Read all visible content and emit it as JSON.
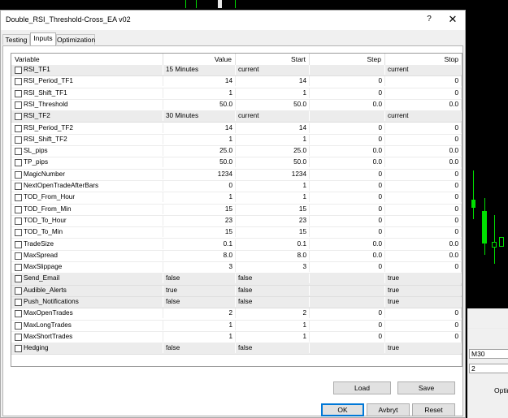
{
  "dialog": {
    "title": "Double_RSI_Threshold-Cross_EA v02",
    "help_label": "?",
    "close_label": "✕"
  },
  "tabs": [
    {
      "label": "Testing"
    },
    {
      "label": "Inputs"
    },
    {
      "label": "Optimization"
    }
  ],
  "columns": [
    "Variable",
    "Value",
    "Start",
    "Step",
    "Stop"
  ],
  "rows": [
    {
      "name": "RSI_TF1",
      "value": "15 Minutes",
      "start": "current",
      "step": "",
      "stop": "current",
      "kind": "text"
    },
    {
      "name": "RSI_Period_TF1",
      "value": "14",
      "start": "14",
      "step": "0",
      "stop": "0",
      "kind": "num"
    },
    {
      "name": "RSI_Shift_TF1",
      "value": "1",
      "start": "1",
      "step": "0",
      "stop": "0",
      "kind": "num"
    },
    {
      "name": "RSI_Threshold",
      "value": "50.0",
      "start": "50.0",
      "step": "0.0",
      "stop": "0.0",
      "kind": "num"
    },
    {
      "name": "RSI_TF2",
      "value": "30 Minutes",
      "start": "current",
      "step": "",
      "stop": "current",
      "kind": "text"
    },
    {
      "name": "RSI_Period_TF2",
      "value": "14",
      "start": "14",
      "step": "0",
      "stop": "0",
      "kind": "num"
    },
    {
      "name": "RSI_Shift_TF2",
      "value": "1",
      "start": "1",
      "step": "0",
      "stop": "0",
      "kind": "num"
    },
    {
      "name": "SL_pips",
      "value": "25.0",
      "start": "25.0",
      "step": "0.0",
      "stop": "0.0",
      "kind": "num"
    },
    {
      "name": "TP_pips",
      "value": "50.0",
      "start": "50.0",
      "step": "0.0",
      "stop": "0.0",
      "kind": "num"
    },
    {
      "name": "MagicNumber",
      "value": "1234",
      "start": "1234",
      "step": "0",
      "stop": "0",
      "kind": "num"
    },
    {
      "name": "NextOpenTradeAfterBars",
      "value": "0",
      "start": "1",
      "step": "0",
      "stop": "0",
      "kind": "num"
    },
    {
      "name": "TOD_From_Hour",
      "value": "1",
      "start": "1",
      "step": "0",
      "stop": "0",
      "kind": "num"
    },
    {
      "name": "TOD_From_Min",
      "value": "15",
      "start": "15",
      "step": "0",
      "stop": "0",
      "kind": "num"
    },
    {
      "name": "TOD_To_Hour",
      "value": "23",
      "start": "23",
      "step": "0",
      "stop": "0",
      "kind": "num"
    },
    {
      "name": "TOD_To_Min",
      "value": "15",
      "start": "15",
      "step": "0",
      "stop": "0",
      "kind": "num"
    },
    {
      "name": "TradeSize",
      "value": "0.1",
      "start": "0.1",
      "step": "0.0",
      "stop": "0.0",
      "kind": "num"
    },
    {
      "name": "MaxSpread",
      "value": "8.0",
      "start": "8.0",
      "step": "0.0",
      "stop": "0.0",
      "kind": "num"
    },
    {
      "name": "MaxSlippage",
      "value": "3",
      "start": "3",
      "step": "0",
      "stop": "0",
      "kind": "num"
    },
    {
      "name": "Send_Email",
      "value": "false",
      "start": "false",
      "step": "",
      "stop": "true",
      "kind": "text"
    },
    {
      "name": "Audible_Alerts",
      "value": "true",
      "start": "false",
      "step": "",
      "stop": "true",
      "kind": "text"
    },
    {
      "name": "Push_Notifications",
      "value": "false",
      "start": "false",
      "step": "",
      "stop": "true",
      "kind": "text"
    },
    {
      "name": "MaxOpenTrades",
      "value": "2",
      "start": "2",
      "step": "0",
      "stop": "0",
      "kind": "num"
    },
    {
      "name": "MaxLongTrades",
      "value": "1",
      "start": "1",
      "step": "0",
      "stop": "0",
      "kind": "num"
    },
    {
      "name": "MaxShortTrades",
      "value": "1",
      "start": "1",
      "step": "0",
      "stop": "0",
      "kind": "num"
    },
    {
      "name": "Hedging",
      "value": "false",
      "start": "false",
      "step": "",
      "stop": "true",
      "kind": "text"
    }
  ],
  "buttons": {
    "load": "Load",
    "save": "Save",
    "ok": "OK",
    "cancel": "Avbryt",
    "reset": "Reset"
  },
  "background": {
    "timeframe_value": "M30",
    "field_value": "2",
    "partial_label": "Optin"
  },
  "colors": {
    "chart_bg": "#000000",
    "candle": "#00e000",
    "default_button_border": "#0078d7"
  }
}
